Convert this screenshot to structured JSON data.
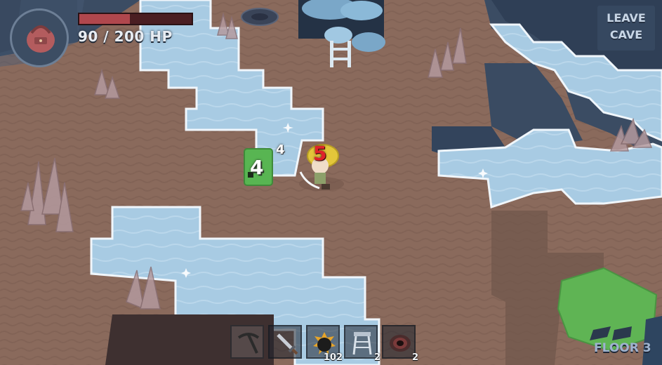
{
  "hud": {
    "hp_current": 90,
    "hp_max": 200,
    "hp_text": "90 / 200 HP",
    "hp_fraction": 0.45,
    "portrait_icon": "backpack-icon"
  },
  "leave_button": {
    "line1": "LEAVE",
    "line2": "CAVE"
  },
  "hotbar": {
    "slots": [
      {
        "icon": "pickaxe-icon",
        "count": ""
      },
      {
        "icon": "sword-icon",
        "count": ""
      },
      {
        "icon": "bomb-icon",
        "count": "102"
      },
      {
        "icon": "rope-ladder-icon",
        "count": "2"
      },
      {
        "icon": "hole-portal-icon",
        "count": "2"
      }
    ]
  },
  "floor": {
    "label": "FLOOR 3"
  },
  "combat": {
    "enemy_damage_big": "4",
    "enemy_damage_small": "4",
    "player_damage": "5"
  },
  "colors": {
    "ground": "#8a6a5c",
    "ice": "#a9cde6",
    "wall": "#3e5068",
    "hp_fill": "#b0474d",
    "slime": "#58b552",
    "player_helmet": "#e3c63a"
  }
}
